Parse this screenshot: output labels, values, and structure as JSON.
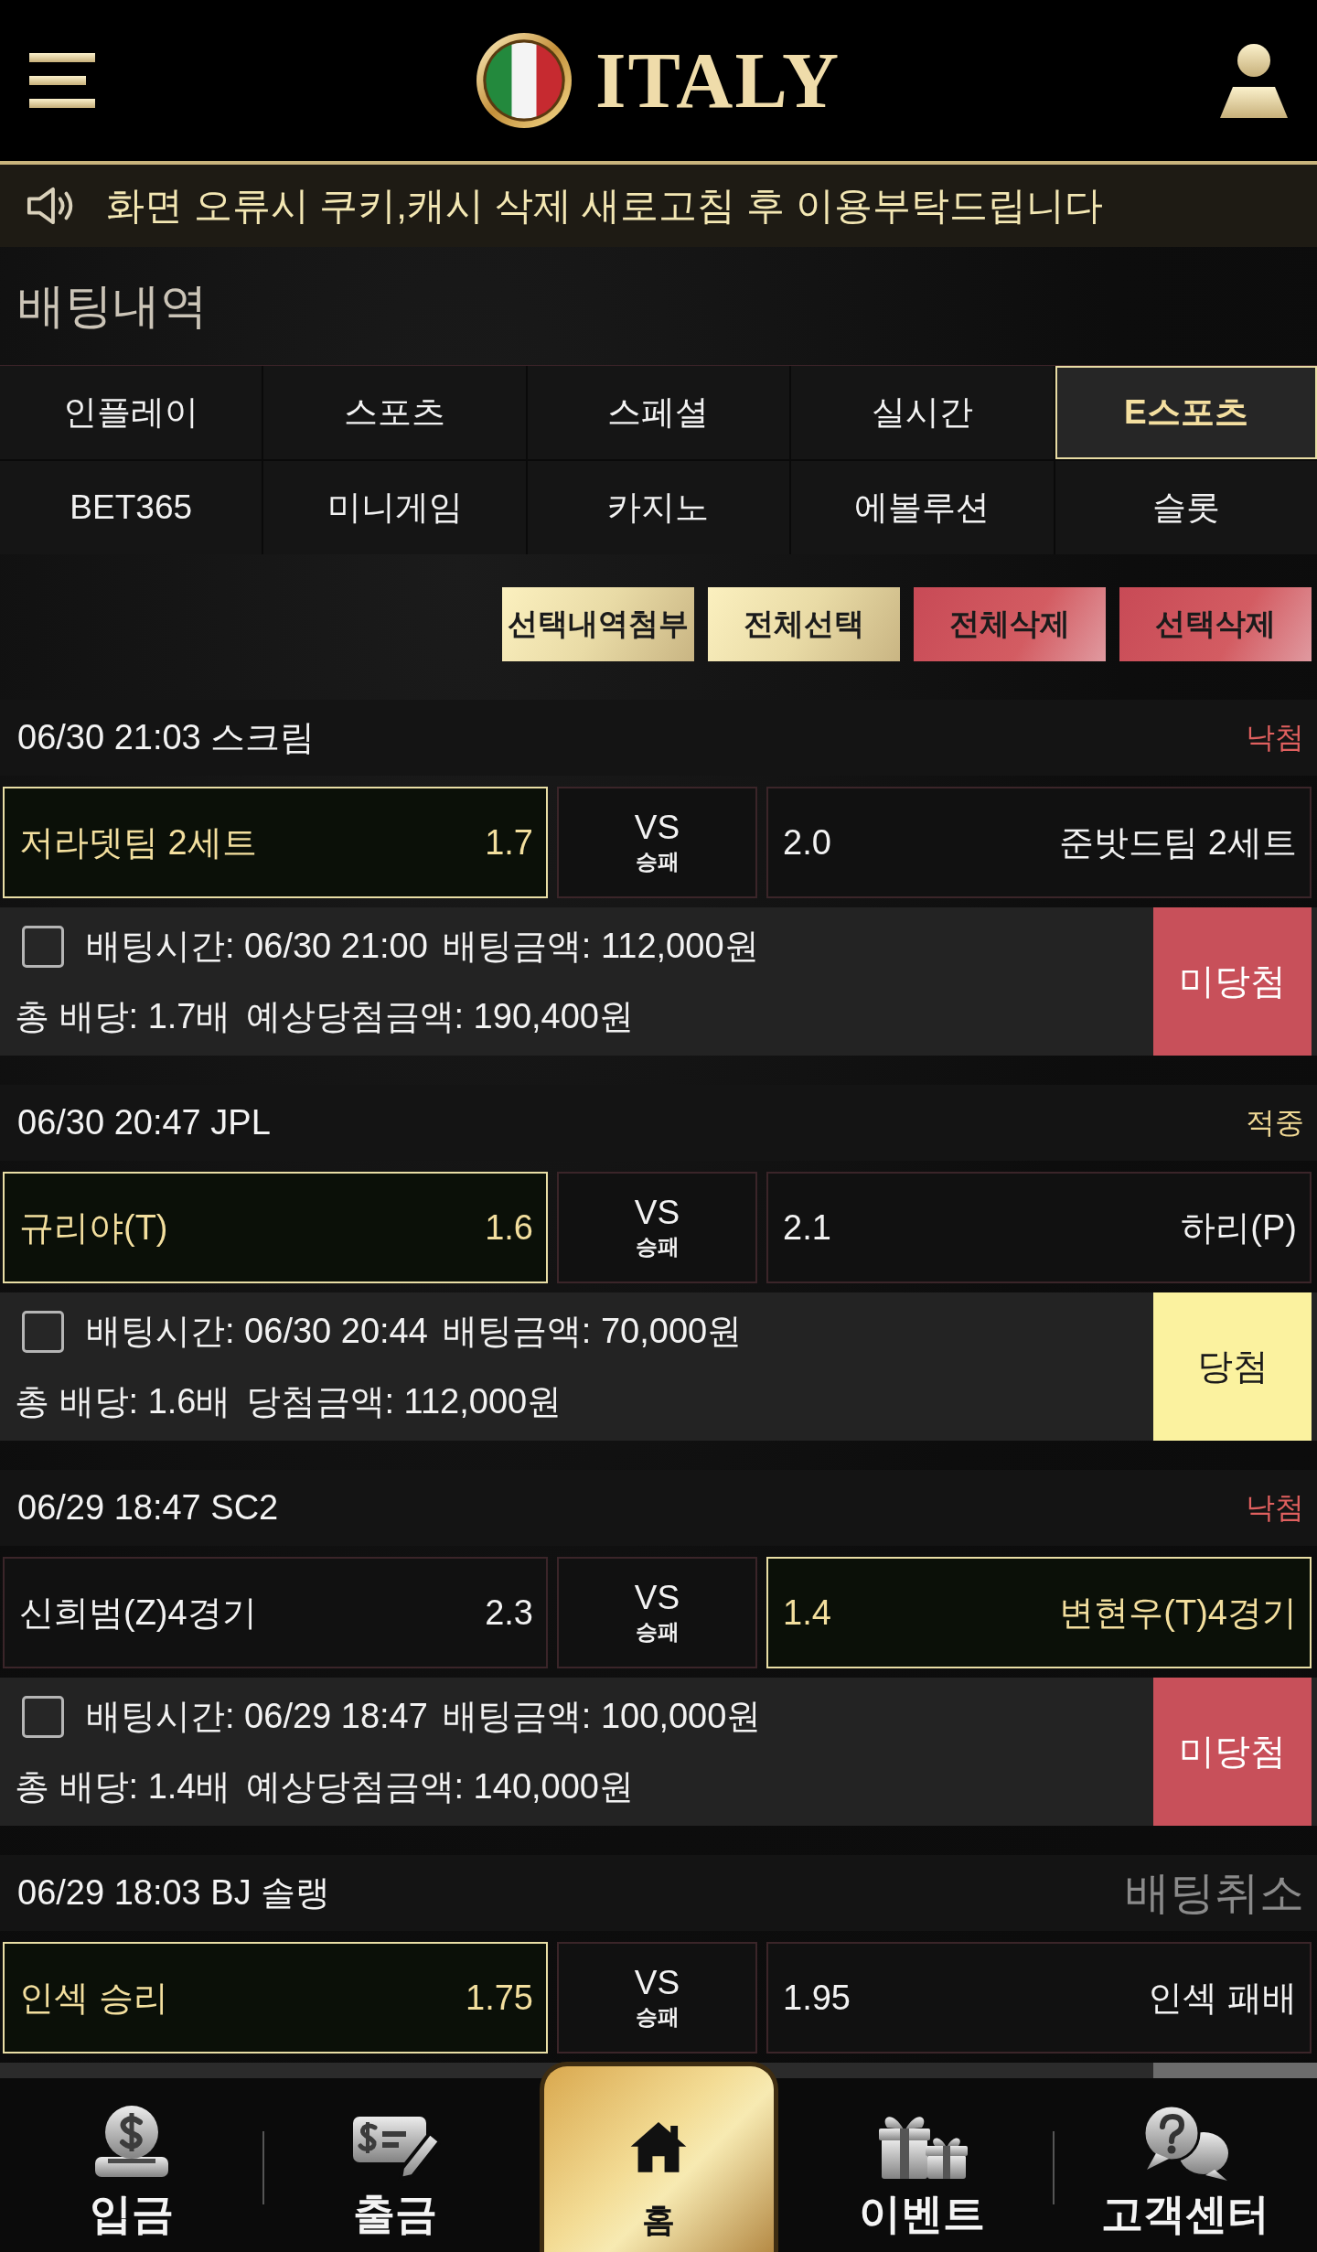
{
  "header": {
    "logo_text": "ITALY"
  },
  "notice": {
    "text": "화면 오류시 쿠키,캐시 삭제 새로고침 후 이용부탁드립니다"
  },
  "page_title": "배팅내역",
  "tabs": [
    {
      "label": "인플레이",
      "selected": false
    },
    {
      "label": "스포츠",
      "selected": false
    },
    {
      "label": "스페셜",
      "selected": false
    },
    {
      "label": "실시간",
      "selected": false
    },
    {
      "label": "E스포츠",
      "selected": true
    },
    {
      "label": "BET365",
      "selected": false
    },
    {
      "label": "미니게임",
      "selected": false
    },
    {
      "label": "카지노",
      "selected": false
    },
    {
      "label": "에볼루션",
      "selected": false
    },
    {
      "label": "슬롯",
      "selected": false
    }
  ],
  "actions": [
    {
      "label": "선택내역첨부",
      "kind": "gold"
    },
    {
      "label": "전체선택",
      "kind": "gold"
    },
    {
      "label": "전체삭제",
      "kind": "red"
    },
    {
      "label": "선택삭제",
      "kind": "red"
    }
  ],
  "bets": [
    {
      "datetime": "06/30 21:03 스크림",
      "status": {
        "label": "낙첨",
        "kind": "lost"
      },
      "home": {
        "team": "저라뎃팀 2세트",
        "odds": "1.7",
        "selected": true
      },
      "versus": "VS",
      "market": "승패",
      "away": {
        "team": "준밧드팀 2세트",
        "odds": "2.0",
        "selected": false
      },
      "details": {
        "checked": false,
        "bet_time": "배팅시간: 06/30 21:00",
        "bet_amount": "배팅금액: 112,000원",
        "total_odds": "총 배당: 1.7배",
        "payout": "예상당첨금액: 190,400원",
        "result": {
          "label": "미당첨",
          "kind": "lost"
        }
      }
    },
    {
      "datetime": "06/30 20:47 JPL",
      "status": {
        "label": "적중",
        "kind": "won"
      },
      "home": {
        "team": "규리야(T)",
        "odds": "1.6",
        "selected": true
      },
      "versus": "VS",
      "market": "승패",
      "away": {
        "team": "하리(P)",
        "odds": "2.1",
        "selected": false
      },
      "details": {
        "checked": false,
        "bet_time": "배팅시간: 06/30 20:44",
        "bet_amount": "배팅금액: 70,000원",
        "total_odds": "총 배당: 1.6배",
        "payout": "당첨금액: 112,000원",
        "result": {
          "label": "당첨",
          "kind": "won"
        }
      }
    },
    {
      "datetime": "06/29 18:47 SC2",
      "status": {
        "label": "낙첨",
        "kind": "lost"
      },
      "home": {
        "team": "신희범(Z)4경기",
        "odds": "2.3",
        "selected": false
      },
      "versus": "VS",
      "market": "승패",
      "away": {
        "team": "변현우(T)4경기",
        "odds": "1.4",
        "selected": true
      },
      "details": {
        "checked": false,
        "bet_time": "배팅시간: 06/29 18:47",
        "bet_amount": "배팅금액: 100,000원",
        "total_odds": "총 배당: 1.4배",
        "payout": "예상당첨금액: 140,000원",
        "result": {
          "label": "미당첨",
          "kind": "lost"
        }
      }
    },
    {
      "datetime": "06/29 18:03 BJ 솔랭",
      "status": {
        "label": "배팅취소",
        "kind": "cancelled"
      },
      "home": {
        "team": "인섹 승리",
        "odds": "1.75",
        "selected": true
      },
      "versus": "VS",
      "market": "승패",
      "away": {
        "team": "인섹 패배",
        "odds": "1.95",
        "selected": false
      },
      "details": {
        "result": {
          "kind": "cancelled"
        }
      }
    }
  ],
  "bottom_nav": [
    {
      "label": "입금",
      "kind": "deposit",
      "selected": false
    },
    {
      "label": "출금",
      "kind": "withdraw",
      "selected": false
    },
    {
      "label": "홈",
      "kind": "home",
      "selected": true
    },
    {
      "label": "이벤트",
      "kind": "event",
      "selected": false
    },
    {
      "label": "고객센터",
      "kind": "support",
      "selected": false
    }
  ]
}
